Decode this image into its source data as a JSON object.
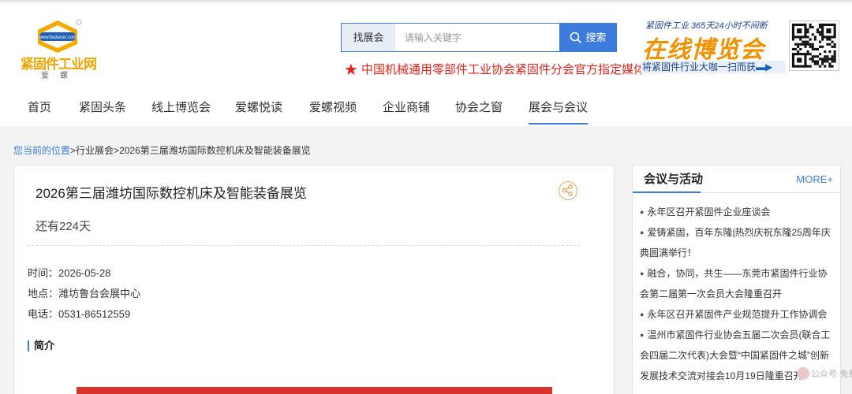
{
  "header": {
    "logo": {
      "name": "紧固件工业网",
      "sub": "爱螺",
      "url_text": "www.fastener.com"
    },
    "search": {
      "category": "找展会",
      "placeholder": "请输入关键字",
      "button": "搜索"
    },
    "slogan": "中国机械通用零部件工业协会紧固件分会官方指定媒体",
    "expo": {
      "tagline": "紧固件工业  365天24小时不间断",
      "title": "在线博览会",
      "cta": "将紧固件行业大咖一扫而获"
    }
  },
  "nav": {
    "items": [
      {
        "label": "首页"
      },
      {
        "label": "紧固头条"
      },
      {
        "label": "线上博览会"
      },
      {
        "label": "爱螺悦读"
      },
      {
        "label": "爱螺视频"
      },
      {
        "label": "企业商铺"
      },
      {
        "label": "协会之窗"
      },
      {
        "label": "展会与会议"
      }
    ],
    "active_index": 7
  },
  "breadcrumb": {
    "here": "您当前的位置",
    "sep": ">",
    "level1": "行业展会",
    "level2": "2026第三届潍坊国际数控机床及智能装备展览"
  },
  "event": {
    "title": "2026第三届潍坊国际数控机床及智能装备展览",
    "countdown": "还有224天",
    "time_text": "时间：2026-05-28",
    "place_text": "地点：潍坊鲁台会展中心",
    "phone_text": "电话：0531-86512559",
    "intro_heading": "简介"
  },
  "sidebar": {
    "title": "会议与活动",
    "more": "MORE+",
    "items": [
      "永年区召开紧固件企业座谈会",
      "爱铸紧固，百年东隆|热烈庆祝东隆25周年庆典圆满举行！",
      "融合，协同，共生——东莞市紧固件行业协会第二届第一次会员大会隆重召开",
      "永年区召开紧固件产业规范提升工作协调会",
      "温州市紧固件行业协会五届二次会员(联合工会四届二次代表)大会暨“中国紧固件之城”创新发展技术交流对接会10月19日隆重召开"
    ]
  },
  "watermark": "公众号·免费",
  "colors": {
    "accent": "#3d7bdc",
    "slogan_red": "#e2231a",
    "expo_orange": "#f29100",
    "logo_gold": "#f0a400",
    "banner_red": "#d8332d"
  }
}
